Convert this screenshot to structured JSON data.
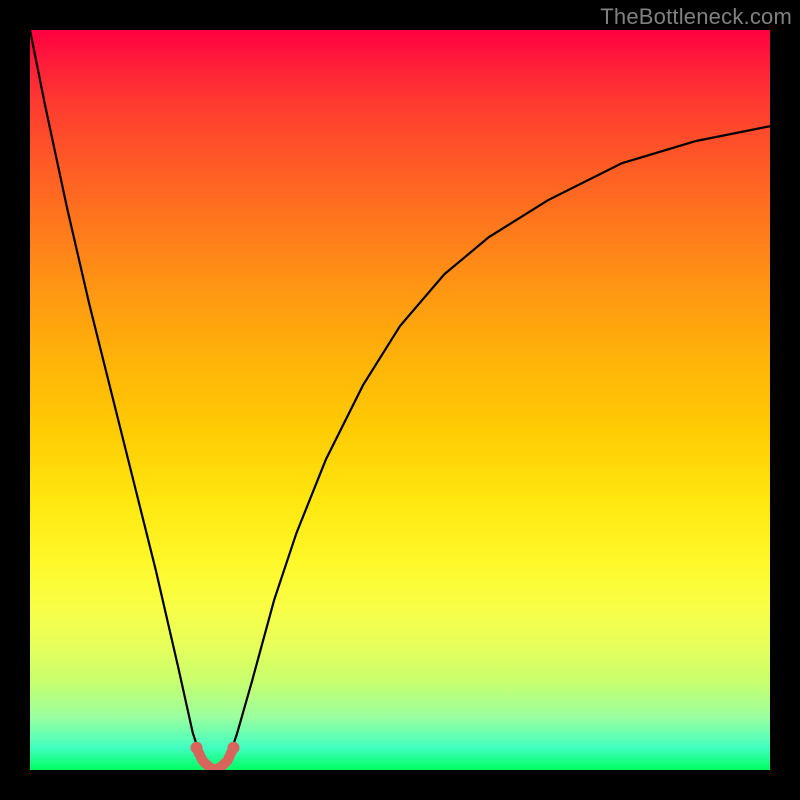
{
  "watermark": "TheBottleneck.com",
  "colors": {
    "frame": "#000000",
    "gradient_top": "#ff0040",
    "gradient_bottom": "#00ff60",
    "curve": "#000000",
    "marker": "#d8645c"
  },
  "chart_data": {
    "type": "line",
    "title": "",
    "xlabel": "",
    "ylabel": "",
    "xlim": [
      0,
      100
    ],
    "ylim": [
      0,
      100
    ],
    "grid": false,
    "legend": false,
    "annotations": [],
    "series": [
      {
        "name": "bottleneck-curve",
        "x": [
          0,
          2,
          5,
          8,
          11,
          14,
          17,
          20,
          22,
          23,
          24,
          25,
          26,
          27,
          28,
          30,
          33,
          36,
          40,
          45,
          50,
          56,
          62,
          70,
          80,
          90,
          100
        ],
        "y": [
          100,
          90,
          76,
          63,
          51,
          39,
          27,
          14,
          5,
          2,
          0.5,
          0,
          0.5,
          2,
          5,
          12,
          23,
          32,
          42,
          52,
          60,
          67,
          72,
          77,
          82,
          85,
          87
        ]
      }
    ],
    "markers": {
      "name": "min-region",
      "x": [
        22.5,
        23.3,
        24.2,
        25.0,
        25.8,
        26.7,
        27.5
      ],
      "y": [
        3.0,
        1.3,
        0.4,
        0.0,
        0.4,
        1.3,
        3.0
      ]
    }
  }
}
